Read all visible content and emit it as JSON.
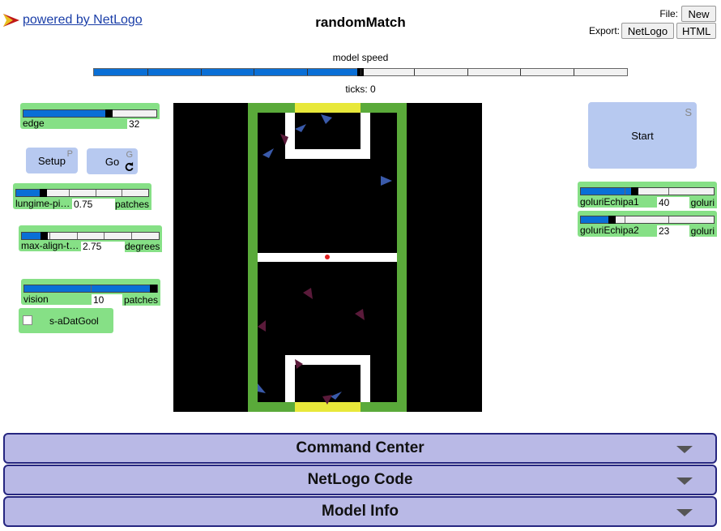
{
  "header": {
    "powered_by": "powered by NetLogo",
    "title": "randomMatch",
    "file_label": "File:",
    "new_label": "New",
    "export_label": "Export:",
    "export_netlogo_label": "NetLogo",
    "export_html_label": "HTML"
  },
  "speed": {
    "label": "model speed",
    "value_fraction": 0.5
  },
  "ticks": {
    "text": "ticks: 0"
  },
  "widgets": {
    "edge": {
      "label": "edge",
      "value": "32",
      "fraction": 0.64
    },
    "setup": {
      "label": "Setup",
      "hotkey": "P"
    },
    "go": {
      "label": "Go",
      "hotkey": "G"
    },
    "lungime": {
      "label": "lungime-pi…",
      "value": "0.75",
      "unit": "patches",
      "fraction": 0.2
    },
    "maxalign": {
      "label": "max-align-t…",
      "value": "2.75",
      "unit": "degrees",
      "fraction": 0.16
    },
    "vision": {
      "label": "vision",
      "value": "10",
      "unit": "patches",
      "fraction": 0.97
    },
    "adatgool": {
      "label": "s-aDatGool",
      "checked": false
    },
    "start": {
      "label": "Start",
      "hotkey": "S"
    },
    "goluri1": {
      "label": "goluriEchipa1",
      "value": "40",
      "unit": "goluri",
      "fraction": 0.4
    },
    "goluri2": {
      "label": "goluriEchipa2",
      "value": "23",
      "unit": "goluri",
      "fraction": 0.23
    }
  },
  "sections": {
    "command_center": "Command Center",
    "netlogo_code": "NetLogo Code",
    "model_info": "Model Info"
  },
  "colors": {
    "pitch_green": "#5aaa3a",
    "goal_yellow": "#e8e83a",
    "team1": "#3a5aaa",
    "team2": "#5a1a3a",
    "ball": "#e02020"
  }
}
